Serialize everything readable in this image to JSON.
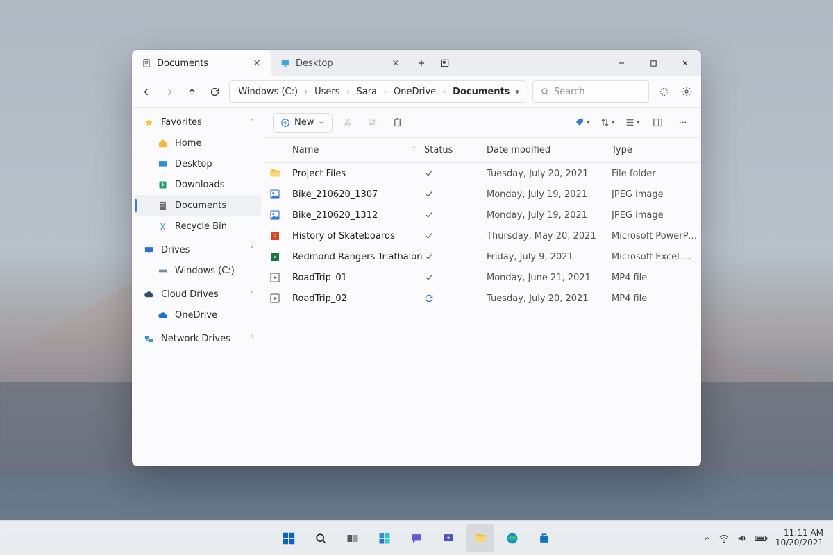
{
  "tabs": [
    {
      "label": "Documents",
      "icon": "document-icon",
      "active": true
    },
    {
      "label": "Desktop",
      "icon": "desktop-folder-icon",
      "active": false
    }
  ],
  "breadcrumb": [
    "Windows (C:)",
    "Users",
    "Sara",
    "OneDrive",
    "Documents"
  ],
  "search": {
    "placeholder": "Search"
  },
  "actionbar": {
    "new_label": "New"
  },
  "sidebar": {
    "groups": [
      {
        "name": "favorites",
        "label": "Favorites",
        "icon": "star-icon",
        "expanded": true,
        "items": [
          {
            "label": "Home",
            "icon": "home-icon"
          },
          {
            "label": "Desktop",
            "icon": "desktop-icon"
          },
          {
            "label": "Downloads",
            "icon": "downloads-icon"
          },
          {
            "label": "Documents",
            "icon": "documents-icon",
            "selected": true
          },
          {
            "label": "Recycle Bin",
            "icon": "recycle-icon"
          }
        ]
      },
      {
        "name": "drives",
        "label": "Drives",
        "icon": "monitor-icon",
        "expanded": true,
        "items": [
          {
            "label": "Windows (C:)",
            "icon": "drive-icon"
          }
        ]
      },
      {
        "name": "cloud",
        "label": "Cloud Drives",
        "icon": "cloud-icon",
        "expanded": true,
        "items": [
          {
            "label": "OneDrive",
            "icon": "onedrive-icon"
          }
        ]
      },
      {
        "name": "network",
        "label": "Network Drives",
        "icon": "network-icon",
        "expanded": false,
        "items": []
      }
    ]
  },
  "columns": [
    "Name",
    "Status",
    "Date modified",
    "Type"
  ],
  "sort": {
    "column": "Name",
    "dir": "asc"
  },
  "files": [
    {
      "name": "Project Files",
      "icon": "folder",
      "status": "synced",
      "date": "Tuesday, July 20, 2021",
      "type": "File folder"
    },
    {
      "name": "Bike_210620_1307",
      "icon": "image",
      "status": "synced",
      "date": "Monday, July 19, 2021",
      "type": "JPEG image"
    },
    {
      "name": "Bike_210620_1312",
      "icon": "image",
      "status": "synced",
      "date": "Monday, July 19, 2021",
      "type": "JPEG image"
    },
    {
      "name": "History of Skateboards",
      "icon": "pptx",
      "status": "synced",
      "date": "Thursday, May 20, 2021",
      "type": "Microsoft PowerPoi…"
    },
    {
      "name": "Redmond Rangers Triathalon",
      "icon": "xlsx",
      "status": "synced",
      "date": "Friday, July 9, 2021",
      "type": "Microsoft Excel Spr…"
    },
    {
      "name": "RoadTrip_01",
      "icon": "video",
      "status": "synced",
      "date": "Monday, June 21, 2021",
      "type": "MP4 file"
    },
    {
      "name": "RoadTrip_02",
      "icon": "video",
      "status": "syncing",
      "date": "Tuesday, July 20, 2021",
      "type": "MP4 file"
    }
  ],
  "taskbar": {
    "apps": [
      "start",
      "search",
      "taskview",
      "widgets",
      "chat",
      "teams",
      "explorer",
      "edge",
      "store"
    ],
    "tray": [
      "chevron-up",
      "wifi",
      "volume",
      "battery"
    ],
    "time": "11:11 AM",
    "date": "10/20/2021"
  }
}
